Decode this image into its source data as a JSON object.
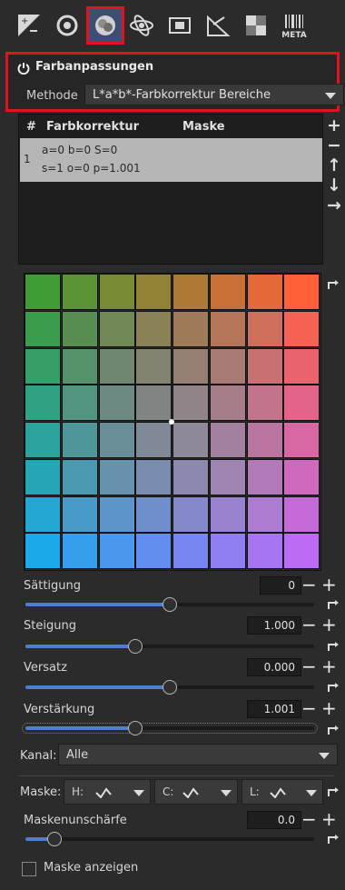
{
  "toolbar": {
    "tools": [
      {
        "icon": "exposure-icon"
      },
      {
        "icon": "detail-icon"
      },
      {
        "icon": "color-icon",
        "active": true
      },
      {
        "icon": "advanced-icon"
      },
      {
        "icon": "transform-icon"
      },
      {
        "icon": "raw-icon"
      },
      {
        "icon": "local-adjustments-icon"
      },
      {
        "icon": "metadata-icon",
        "label": "META"
      }
    ]
  },
  "panel": {
    "title": "Farbanpassungen",
    "method_label": "Methode",
    "method_value": "L*a*b*-Farbkorrektur Bereiche"
  },
  "list": {
    "headers": {
      "num": "#",
      "correction": "Farbkorrektur",
      "mask": "Maske"
    },
    "rows": [
      {
        "num": "1",
        "line1": "a=0 b=0 S=0",
        "line2": "s=1 o=0 p=1.001"
      }
    ],
    "buttons": {
      "add": "+",
      "remove": "−",
      "up": "↑",
      "down": "↓",
      "copy": "→"
    }
  },
  "sliders": {
    "saturation": {
      "label": "Sättigung",
      "value": "0",
      "fraction": 0.5
    },
    "slope": {
      "label": "Steigung",
      "value": "1.000",
      "fraction": 0.38
    },
    "offset": {
      "label": "Versatz",
      "value": "0.000",
      "fraction": 0.5
    },
    "power": {
      "label": "Verstärkung",
      "value": "1.001",
      "fraction": 0.38
    },
    "mask_blur": {
      "label": "Maskenunschärfe",
      "value": "0.0",
      "fraction": 0.1
    }
  },
  "channel": {
    "label": "Kanal:",
    "value": "Alle"
  },
  "mask": {
    "label": "Maske:",
    "buttons": [
      {
        "label": "H:"
      },
      {
        "label": "C:"
      },
      {
        "label": "L:"
      }
    ]
  },
  "show_mask": {
    "label": "Maske anzeigen",
    "checked": false
  },
  "colors": {
    "accent": "#4d7fd1",
    "highlight": "#e0141e",
    "row_selected": "#b6b6b6"
  }
}
